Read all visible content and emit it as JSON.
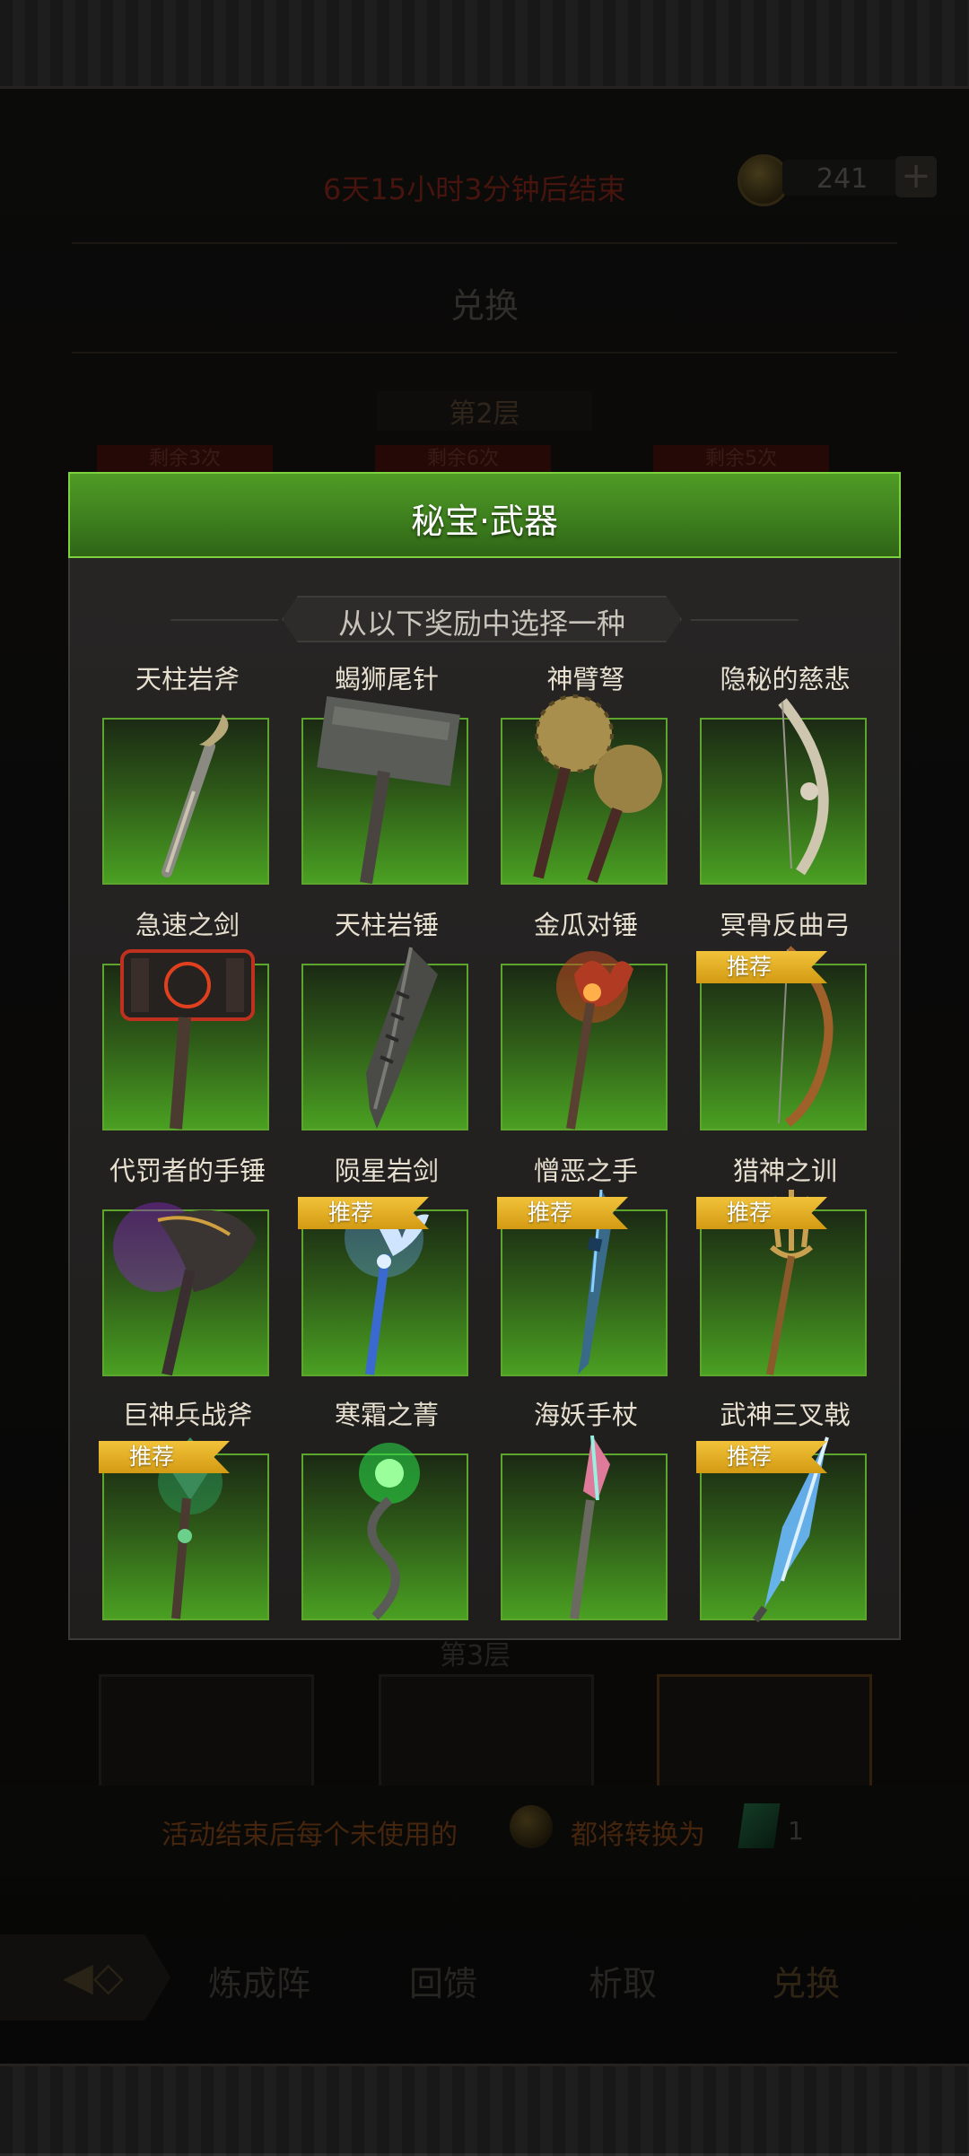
{
  "header": {
    "countdown": "6天15小时3分钟后结束",
    "currency_amount": "241",
    "plus_label": "+",
    "exchange_title": "兑换",
    "layer2_label": "第2层",
    "layer3_label": "第3层",
    "remain_tags": [
      "剩余3次",
      "剩余6次",
      "剩余5次"
    ]
  },
  "modal": {
    "title": "秘宝·武器",
    "subtitle": "从以下奖励中选择一种",
    "recommend_label": "推荐",
    "items": [
      {
        "name": "天柱岩斧",
        "recommended": false,
        "icon": "greataxe-icon"
      },
      {
        "name": "蝎狮尾针",
        "recommended": false,
        "icon": "stone-hammer-icon"
      },
      {
        "name": "神臂弩",
        "recommended": false,
        "icon": "twin-mace-icon"
      },
      {
        "name": "隐秘的慈悲",
        "recommended": false,
        "icon": "bone-bow-icon"
      },
      {
        "name": "急速之剑",
        "recommended": false,
        "icon": "red-warhammer-icon"
      },
      {
        "name": "天柱岩锤",
        "recommended": false,
        "icon": "serrated-blade-icon"
      },
      {
        "name": "金瓜对锤",
        "recommended": false,
        "icon": "claw-scepter-icon"
      },
      {
        "name": "冥骨反曲弓",
        "recommended": true,
        "icon": "recurve-bow-icon"
      },
      {
        "name": "代罚者的手锤",
        "recommended": false,
        "icon": "purple-axe-icon"
      },
      {
        "name": "陨星岩剑",
        "recommended": true,
        "icon": "frost-staff-icon"
      },
      {
        "name": "憎恶之手",
        "recommended": true,
        "icon": "blue-spear-icon"
      },
      {
        "name": "猎神之训",
        "recommended": true,
        "icon": "trident-icon"
      },
      {
        "name": "巨神兵战斧",
        "recommended": true,
        "icon": "jade-mace-icon"
      },
      {
        "name": "寒霜之菁",
        "recommended": false,
        "icon": "serpent-staff-icon"
      },
      {
        "name": "海妖手杖",
        "recommended": false,
        "icon": "crystal-staff-icon"
      },
      {
        "name": "武神三叉戟",
        "recommended": true,
        "icon": "ice-lance-icon"
      }
    ]
  },
  "notice": {
    "text_before": "活动结束后每个未使用的",
    "text_after": "都将转换为",
    "count": "1"
  },
  "nav": {
    "items": [
      "炼成阵",
      "回馈",
      "析取",
      "兑换"
    ],
    "active": "兑换"
  },
  "colors": {
    "header_green": "#3e7f1e",
    "badge_gold": "#e2ad22",
    "card_green": "#4aa022",
    "countdown_red": "#6e1f16"
  }
}
